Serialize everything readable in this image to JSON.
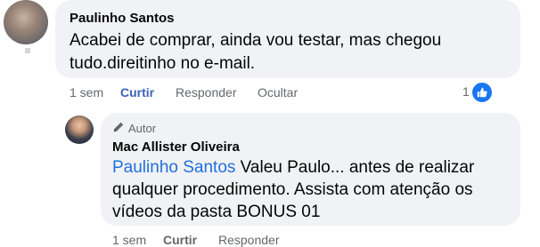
{
  "comment": {
    "author": "Paulinho Santos",
    "text_line1": "Acabei de comprar, ainda vou testar, mas chegou",
    "text_line2": "tudo.direitinho no e-mail.",
    "time": "1 sem",
    "actions": {
      "curtir": "Curtir",
      "responder": "Responder",
      "ocultar": "Ocultar"
    },
    "like_count": "1",
    "like_icon": "thumbs-up-icon",
    "like_color": "#1877f2"
  },
  "reply": {
    "badge_icon": "pencil-icon",
    "badge_label": "Autor",
    "author": "Mac Allister Oliveira",
    "mention": "Paulinho Santos",
    "text_line1_rest": " Valeu Paulo... antes de realizar",
    "text_line2": "qualquer procedimento. Assista com atenção os",
    "text_line3": "vídeos da pasta BONUS 01",
    "time": "1 sem",
    "actions": {
      "curtir": "Curtir",
      "responder": "Responder"
    },
    "mention_color": "#216fdb"
  }
}
